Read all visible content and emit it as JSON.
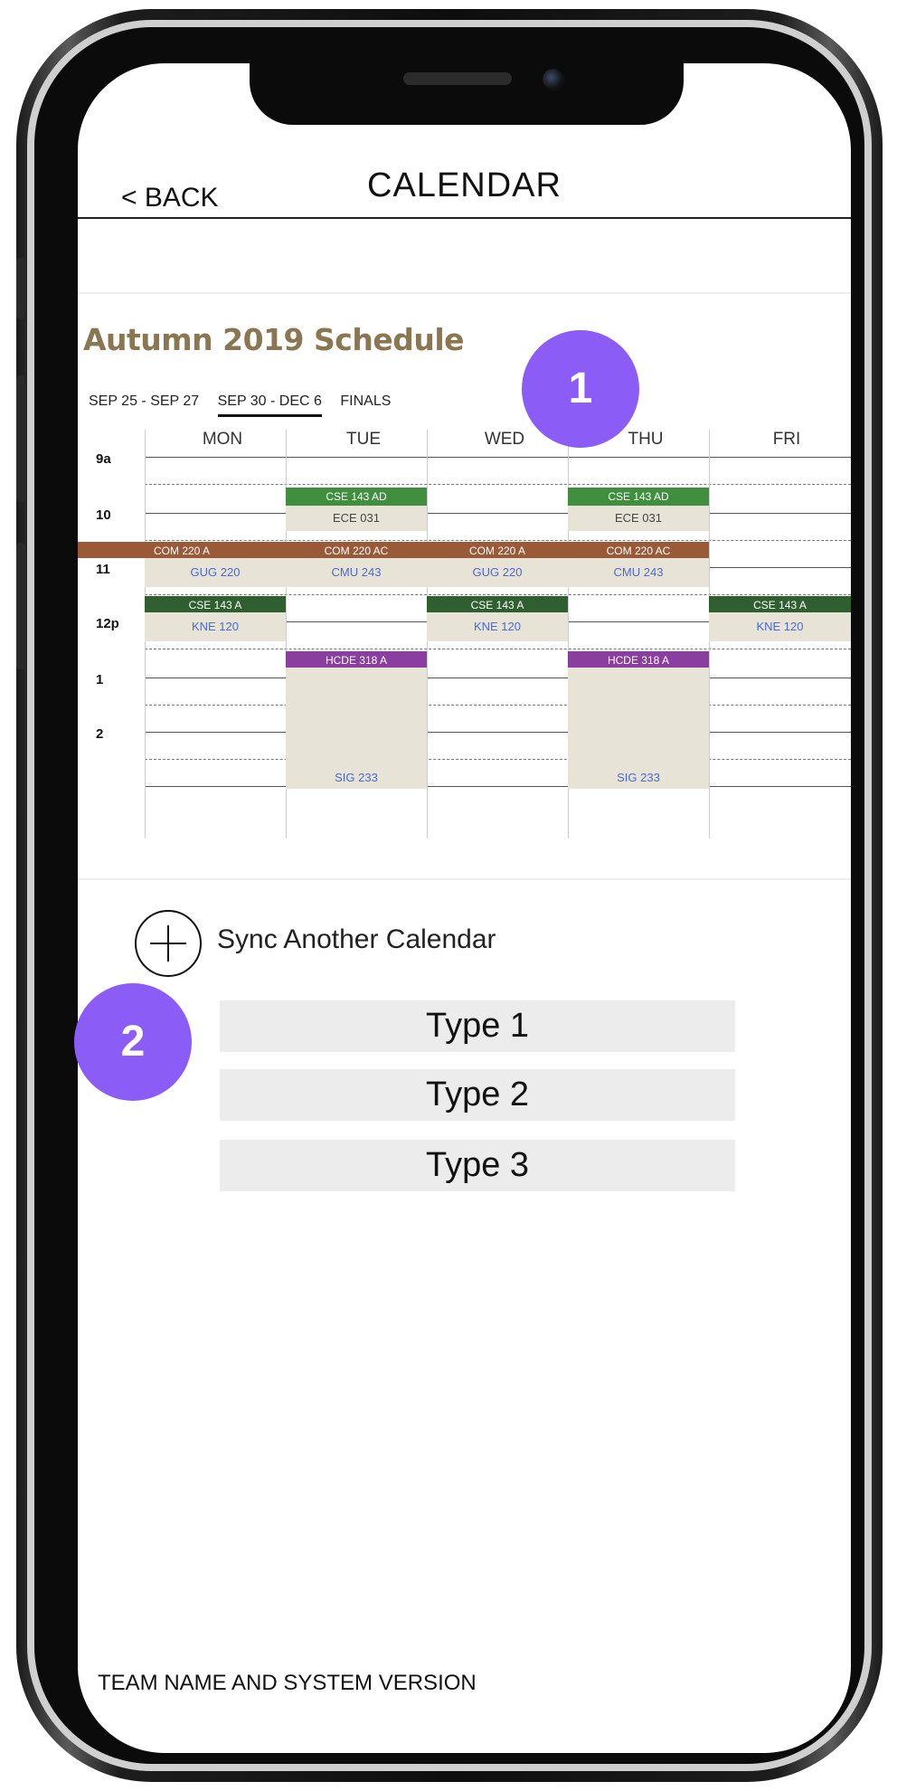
{
  "header": {
    "back_label": "< BACK",
    "title": "CALENDAR"
  },
  "schedule": {
    "title": "Autumn 2019 Schedule",
    "tabs": [
      {
        "label": "SEP 25 - SEP 27",
        "active": false
      },
      {
        "label": "SEP 30 - DEC 6",
        "active": true
      },
      {
        "label": "FINALS",
        "active": false
      }
    ],
    "days": [
      "MON",
      "TUE",
      "WED",
      "THU",
      "FRI"
    ],
    "hours": [
      "9a",
      "10",
      "11",
      "12p",
      "1",
      "2"
    ],
    "events": [
      {
        "course": "CSE 143 AD",
        "room": "ECE 031",
        "color": "#3f8f3f",
        "room_color": "dark"
      },
      {
        "course": "CSE 143 AD",
        "room": "ECE 031",
        "color": "#3f8f3f",
        "room_color": "dark"
      },
      {
        "course": "COM 220 A",
        "room": "GUG 220",
        "color": "#9a5a38",
        "room_color": "blue"
      },
      {
        "course": "COM 220 AC",
        "room": "CMU 243",
        "color": "#9a5a38",
        "room_color": "blue"
      },
      {
        "course": "COM 220 A",
        "room": "GUG 220",
        "color": "#9a5a38",
        "room_color": "blue"
      },
      {
        "course": "COM 220 AC",
        "room": "CMU 243",
        "color": "#9a5a38",
        "room_color": "blue"
      },
      {
        "course": "CSE 143 A",
        "room": "KNE 120",
        "color": "#2f5f2f",
        "room_color": "blue"
      },
      {
        "course": "CSE 143 A",
        "room": "KNE 120",
        "color": "#2f5f2f",
        "room_color": "blue"
      },
      {
        "course": "CSE 143 A",
        "room": "KNE 120",
        "color": "#2f5f2f",
        "room_color": "blue"
      },
      {
        "course": "HCDE 318 A",
        "room": "SIG 233",
        "color": "#8a3ea0",
        "room_color": "blue"
      },
      {
        "course": "HCDE 318 A",
        "room": "SIG 233",
        "color": "#8a3ea0",
        "room_color": "blue"
      }
    ]
  },
  "sync": {
    "label": "Sync Another Calendar",
    "types": [
      "Type 1",
      "Type 2",
      "Type 3"
    ]
  },
  "footer": {
    "text": "TEAM NAME AND SYSTEM VERSION"
  },
  "annotations": {
    "badge1": "1",
    "badge2": "2",
    "color": "#8b5cf6"
  }
}
